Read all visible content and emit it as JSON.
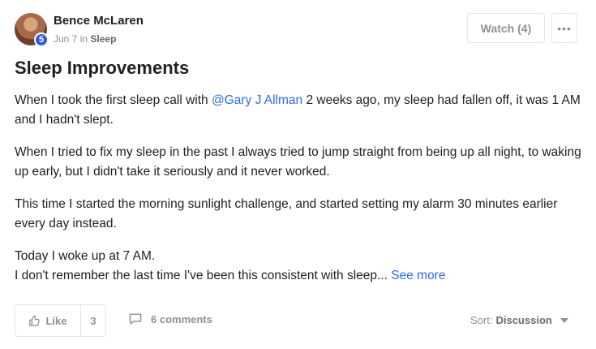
{
  "post": {
    "author": "Bence McLaren",
    "level": "5",
    "date": "Jun 7",
    "in_word": "in",
    "category": "Sleep",
    "title": "Sleep Improvements",
    "p1_before": "When I took the first sleep call with ",
    "mention": "@Gary J Allman",
    "p1_after": " 2 weeks ago, my sleep had fallen off, it was 1 AM and I hadn't slept.",
    "p2": "When I tried to fix my sleep in the past I always tried to jump straight from being up all night, to waking up early, but I didn't take it seriously and it never worked.",
    "p3": "This time I started the morning sunlight challenge, and started setting my alarm 30 minutes earlier every day instead.",
    "p4_line1": "Today I woke up at 7 AM.",
    "p4_line2": "I don't remember the last time I've been this consistent with sleep...",
    "see_more": "See more"
  },
  "header": {
    "watch_label": "Watch (4)",
    "more_label": "•••"
  },
  "footer": {
    "like_label": "Like",
    "like_count": "3",
    "comments_label": "6 comments",
    "sort_label": "Sort:",
    "sort_value": "Discussion"
  },
  "colors": {
    "accent": "#2e6be6",
    "badge": "#3559d6"
  }
}
